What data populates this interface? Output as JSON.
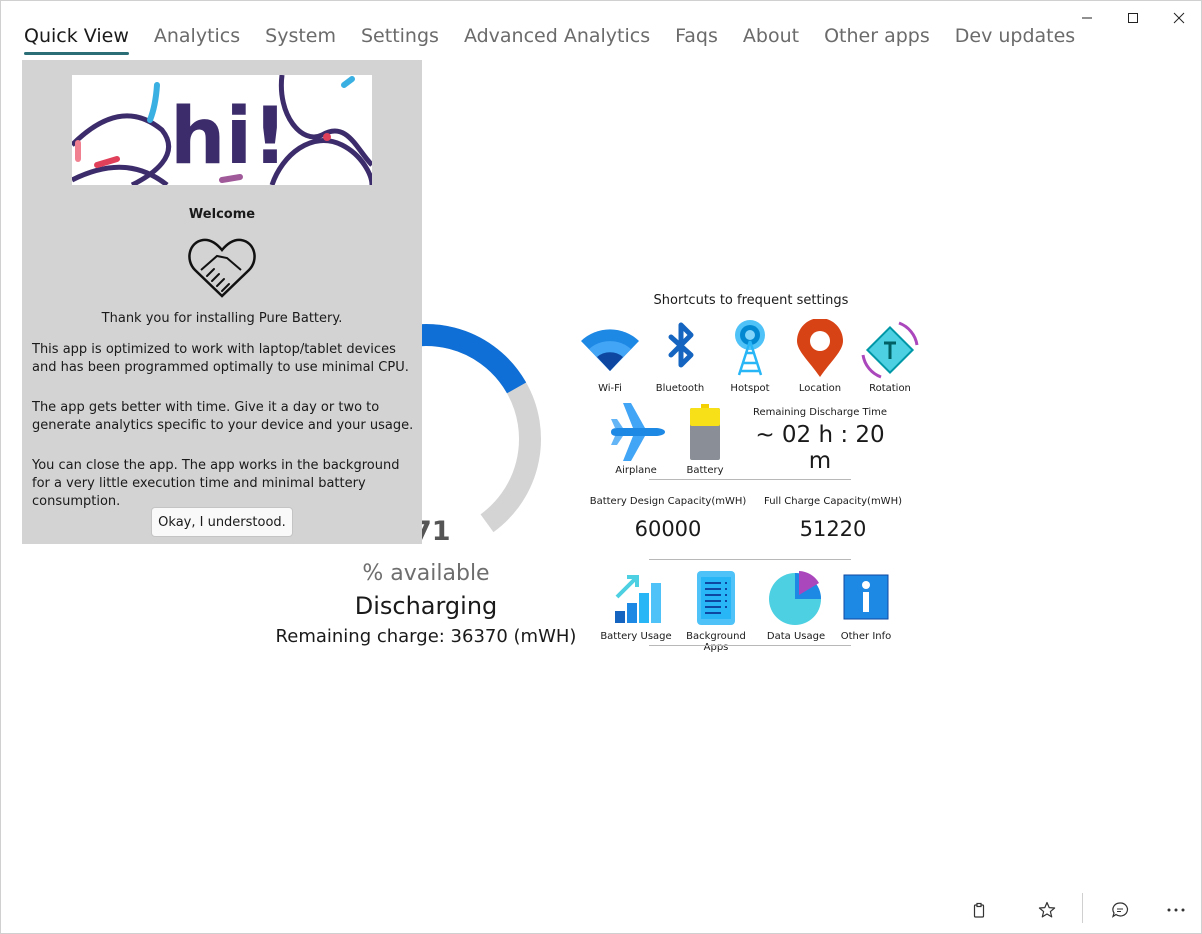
{
  "window": {
    "controls": [
      "minimize-icon",
      "maximize-icon",
      "close-icon"
    ]
  },
  "nav": {
    "tabs": [
      {
        "label": "Quick View",
        "active": true
      },
      {
        "label": "Analytics"
      },
      {
        "label": "System"
      },
      {
        "label": "Settings"
      },
      {
        "label": "Advanced Analytics"
      },
      {
        "label": "Faqs"
      },
      {
        "label": "About"
      },
      {
        "label": "Other apps"
      },
      {
        "label": "Dev updates"
      }
    ]
  },
  "gauge": {
    "percent_partial": "71",
    "fill_fraction": 0.71,
    "available_label": "% available",
    "status": "Discharging",
    "remaining_charge": "Remaining charge: 36370 (mWH)",
    "fill_color": "#0f6fd6",
    "track_color": "#d4d4d4"
  },
  "dialog": {
    "banner_text": "hi!",
    "title": "Welcome",
    "thanks": "Thank you for installing Pure Battery.",
    "para1": "This app is optimized to work with laptop/tablet devices and has been programmed optimally to use minimal CPU.",
    "para2": "The app gets better with time. Give it a day or two to generate analytics specific to your device and your usage.",
    "para3": "You can close the app. The app works in the background for a very little execution time and minimal battery consumption.",
    "ok_button": "Okay, I understood."
  },
  "shortcuts": {
    "title": "Shortcuts to frequent settings",
    "row1": [
      {
        "label": "Wi-Fi",
        "icon": "wifi-icon"
      },
      {
        "label": "Bluetooth",
        "icon": "bluetooth-icon"
      },
      {
        "label": "Hotspot",
        "icon": "hotspot-icon"
      },
      {
        "label": "Location",
        "icon": "location-icon"
      },
      {
        "label": "Rotation",
        "icon": "rotation-icon"
      }
    ],
    "row2": [
      {
        "label": "Airplane",
        "icon": "airplane-icon"
      },
      {
        "label": "Battery",
        "icon": "battery-icon"
      }
    ],
    "discharge": {
      "label": "Remaining Discharge Time",
      "value": "~ 02 h : 20 m"
    },
    "capacity": {
      "design_label": "Battery Design Capacity(mWH)",
      "design_value": "60000",
      "full_label": "Full Charge Capacity(mWH)",
      "full_value": "51220"
    },
    "row3": [
      {
        "label": "Battery Usage",
        "icon": "battery-usage-icon"
      },
      {
        "label": "Background Apps",
        "icon": "background-apps-icon"
      },
      {
        "label": "Data Usage",
        "icon": "data-usage-icon"
      },
      {
        "label": "Other Info",
        "icon": "other-info-icon"
      }
    ]
  },
  "bottom_bar": {
    "buttons": [
      "clipboard-icon",
      "star-icon",
      "feedback-icon",
      "more-icon"
    ]
  }
}
